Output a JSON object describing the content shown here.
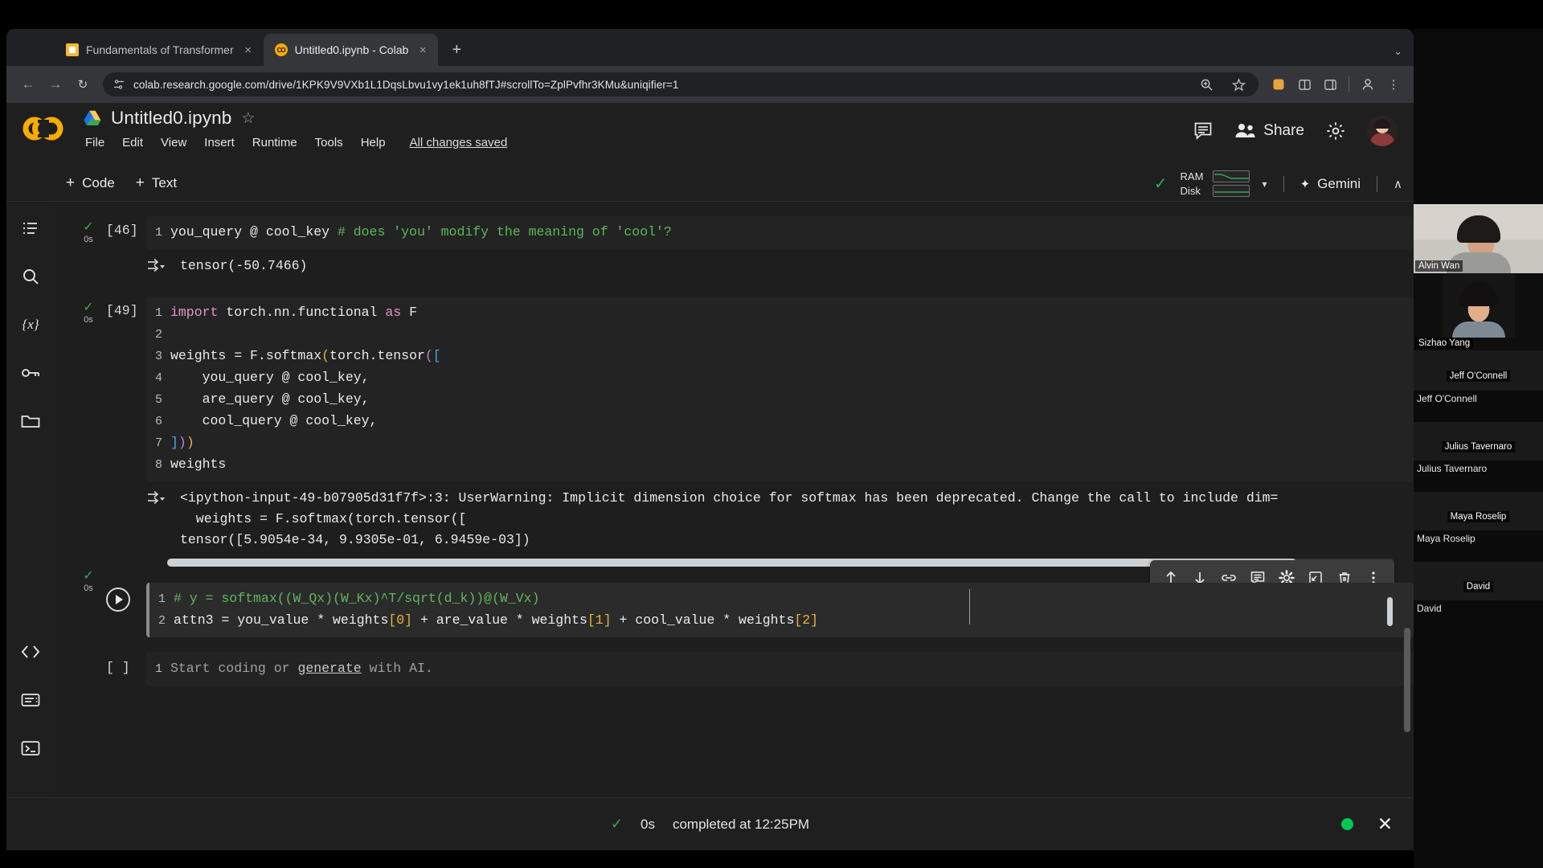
{
  "browser": {
    "tabs": [
      {
        "title": "Fundamentals of Transformer",
        "favicon": "doc-icon",
        "active": false,
        "close": "×"
      },
      {
        "title": "Untitled0.ipynb - Colab",
        "favicon": "colab-icon",
        "favicon_text": "CO",
        "active": true,
        "close": "×"
      }
    ],
    "new_tab_label": "+",
    "tabstrip_menu": "⌄",
    "nav": {
      "back": "←",
      "forward": "→",
      "reload": "↻"
    },
    "url": "colab.research.google.com/drive/1KPK9V9VXb1L1DqsLbvu1vy1ek1uh8fTJ#scrollTo=ZplPvfhr3KMu&uniqifier=1",
    "omnibox_icons": {
      "site_info": "tune-icon",
      "zoom": "search-plus-icon",
      "bookmark": "star-icon"
    },
    "toolbar_icons": {
      "extensions_color": "◆",
      "split": "split-icon",
      "sidepanel": "panel-icon",
      "profile": "profile-icon",
      "menu": "⋮"
    }
  },
  "colab": {
    "logo": "colab-logo",
    "drive_icon": "drive-icon",
    "notebook_title": "Untitled0.ipynb",
    "star_icon": "☆",
    "menu": [
      "File",
      "Edit",
      "View",
      "Insert",
      "Runtime",
      "Tools",
      "Help"
    ],
    "save_status": "All changes saved",
    "header_actions": {
      "comment_icon": "comment-icon",
      "share_label": "Share",
      "settings_icon": "gear-icon",
      "avatar": "user-avatar"
    },
    "toolbar": {
      "add_code": "Code",
      "add_text": "Text",
      "plus": "+",
      "connected_check": "✓",
      "ram_label": "RAM",
      "disk_label": "Disk",
      "caret": "▾",
      "gemini_label": "Gemini",
      "gemini_spark": "✦",
      "collapse": "∧"
    },
    "rail_icons": [
      "table-of-contents-icon",
      "search-icon",
      "variables-icon",
      "secrets-key-icon",
      "files-folder-icon"
    ],
    "rail_bottom_icons": [
      "code-snippets-icon",
      "command-palette-icon",
      "terminal-icon"
    ],
    "cells": [
      {
        "exec_count": "[46]",
        "status_check": "✓",
        "run_time": "0s",
        "lines": [
          {
            "n": "1",
            "code": "you_query @ cool_key ",
            "comment": "# does 'you' modify the meaning of 'cool'?"
          }
        ],
        "output": "tensor(-50.7466)",
        "output_icon": "output-arrow-icon"
      },
      {
        "exec_count": "[49]",
        "status_check": "✓",
        "run_time": "0s",
        "lines": [
          {
            "n": "1",
            "code": "import torch.nn.functional as F"
          },
          {
            "n": "2",
            "code": ""
          },
          {
            "n": "3",
            "code": "weights = F.softmax(torch.tensor(["
          },
          {
            "n": "4",
            "code": "    you_query @ cool_key,"
          },
          {
            "n": "5",
            "code": "    are_query @ cool_key,"
          },
          {
            "n": "6",
            "code": "    cool_query @ cool_key,"
          },
          {
            "n": "7",
            "code": "]))"
          },
          {
            "n": "8",
            "code": "weights"
          }
        ],
        "output_lines": [
          "<ipython-input-49-b07905d31f7f>:3: UserWarning: Implicit dimension choice for softmax has been deprecated. Change the call to include dim=",
          "  weights = F.softmax(torch.tensor([",
          "tensor([5.9054e-34, 9.9305e-01, 6.9459e-03])"
        ],
        "output_icon": "output-arrow-icon"
      },
      {
        "exec_count": "",
        "status_check": "✓",
        "run_time": "0s",
        "active": true,
        "run_button": "run-cell-button",
        "lines": [
          {
            "n": "1",
            "code": "# y = softmax((W_Qx)(W_Kx)^T/sqrt(d_k))@(W_Vx)"
          },
          {
            "n": "2",
            "code": "attn3 = you_value * weights[0] + are_value * weights[1] + cool_value * weights[2]"
          }
        ],
        "toolbar_icons": [
          "move-cell-up-icon",
          "move-cell-down-icon",
          "link-to-cell-icon",
          "add-comment-icon",
          "cell-settings-icon",
          "open-in-tab-icon",
          "delete-cell-icon",
          "more-options-icon"
        ]
      },
      {
        "exec_count": "[ ]",
        "placeholder_prefix": "Start coding or ",
        "placeholder_link": "generate",
        "placeholder_suffix": " with AI.",
        "line_no": "1"
      }
    ],
    "statusbar": {
      "check": "✓",
      "duration": "0s",
      "message": "completed at 12:25PM",
      "indicator_color": "#00c853",
      "close": "✕"
    }
  },
  "video_call": {
    "participants": [
      {
        "name": "Alvin Wan",
        "has_video": true,
        "label_position": "overlay"
      },
      {
        "name": "Sizhao Yang",
        "has_video": true,
        "label_position": "overlay"
      },
      {
        "name": "Jeff O'Connell",
        "has_video": false,
        "label_position": "center"
      },
      {
        "name": "Julius Tavernaro",
        "has_video": false,
        "label_position": "center"
      },
      {
        "name": "Maya Roselip",
        "has_video": false,
        "label_position": "center"
      },
      {
        "name": "David",
        "has_video": false,
        "label_position": "center"
      }
    ]
  },
  "colors": {
    "accent_orange": "#f9ab00",
    "green": "#34a853",
    "comment_green": "#5db85b",
    "bg_dark": "#1e1e1e"
  }
}
